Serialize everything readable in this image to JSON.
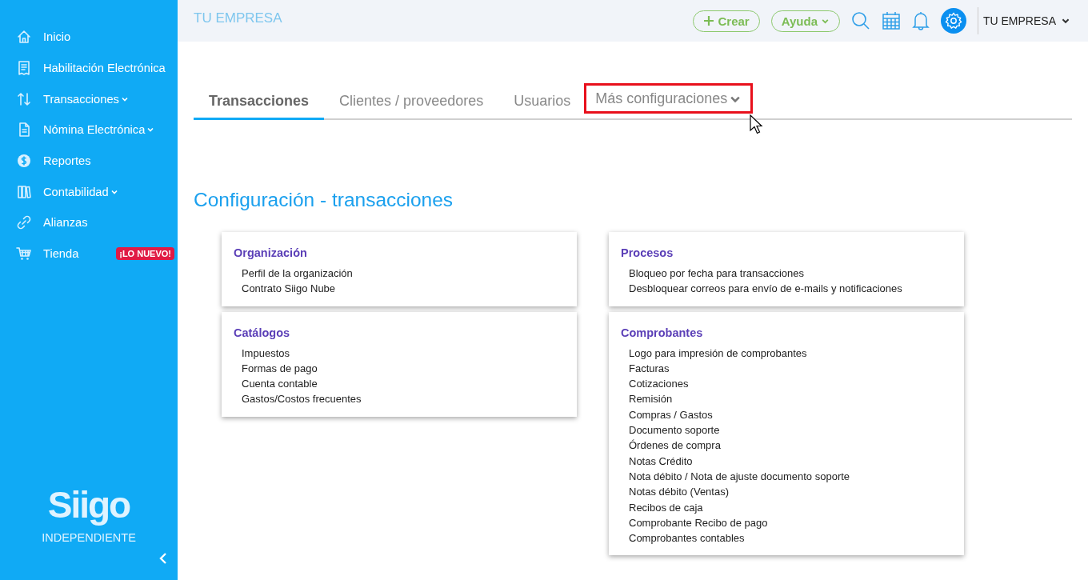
{
  "sidebar": {
    "items": [
      {
        "label": "Inicio",
        "dropdown": false
      },
      {
        "label": "Habilitación Electrónica",
        "dropdown": false
      },
      {
        "label": "Transacciones",
        "dropdown": true
      },
      {
        "label": "Nómina Electrónica",
        "dropdown": true
      },
      {
        "label": "Reportes",
        "dropdown": false
      },
      {
        "label": "Contabilidad",
        "dropdown": true
      },
      {
        "label": "Alianzas",
        "dropdown": false
      },
      {
        "label": "Tienda",
        "dropdown": false,
        "badge": "¡LO NUEVO!"
      }
    ],
    "logo": {
      "name": "Siigo",
      "edition": "INDEPENDIENTE"
    }
  },
  "header": {
    "company": "TU EMPRESA",
    "buttons": [
      {
        "label": "Crear",
        "dropdown": false
      },
      {
        "label": "Ayuda",
        "dropdown": true
      }
    ],
    "user": "TU EMPRESA"
  },
  "tabs": [
    {
      "label": "Transacciones",
      "selected": true,
      "dropdown": false,
      "highlighted": false
    },
    {
      "label": "Clientes / proveedores",
      "selected": false,
      "dropdown": false,
      "highlighted": false
    },
    {
      "label": "Usuarios",
      "selected": false,
      "dropdown": false,
      "highlighted": false
    },
    {
      "label": "Más configuraciones",
      "selected": false,
      "dropdown": true,
      "highlighted": true
    }
  ],
  "heading": "Configuración - transacciones",
  "columns": [
    [
      {
        "title": "Organización",
        "links": [
          "Perfil de la organización",
          "Contrato Siigo Nube"
        ]
      },
      {
        "title": "Catálogos",
        "links": [
          "Impuestos",
          "Formas de pago",
          "Cuenta contable",
          "Gastos/Costos frecuentes"
        ]
      }
    ],
    [
      {
        "title": "Procesos",
        "links": [
          "Bloqueo por fecha para transacciones",
          "Desbloquear correos para envío de e-mails y notificaciones"
        ]
      },
      {
        "title": "Comprobantes",
        "links": [
          "Logo para impresión de comprobantes",
          "Facturas",
          "Cotizaciones",
          "Remisión",
          "Compras / Gastos",
          "Documento soporte",
          "Órdenes de compra",
          "Notas Crédito",
          "Nota débito / Nota de ajuste documento soporte",
          "Notas débito (Ventas)",
          "Recibos de caja",
          "Comprobante Recibo de pago",
          "Comprobantes contables"
        ]
      }
    ]
  ]
}
